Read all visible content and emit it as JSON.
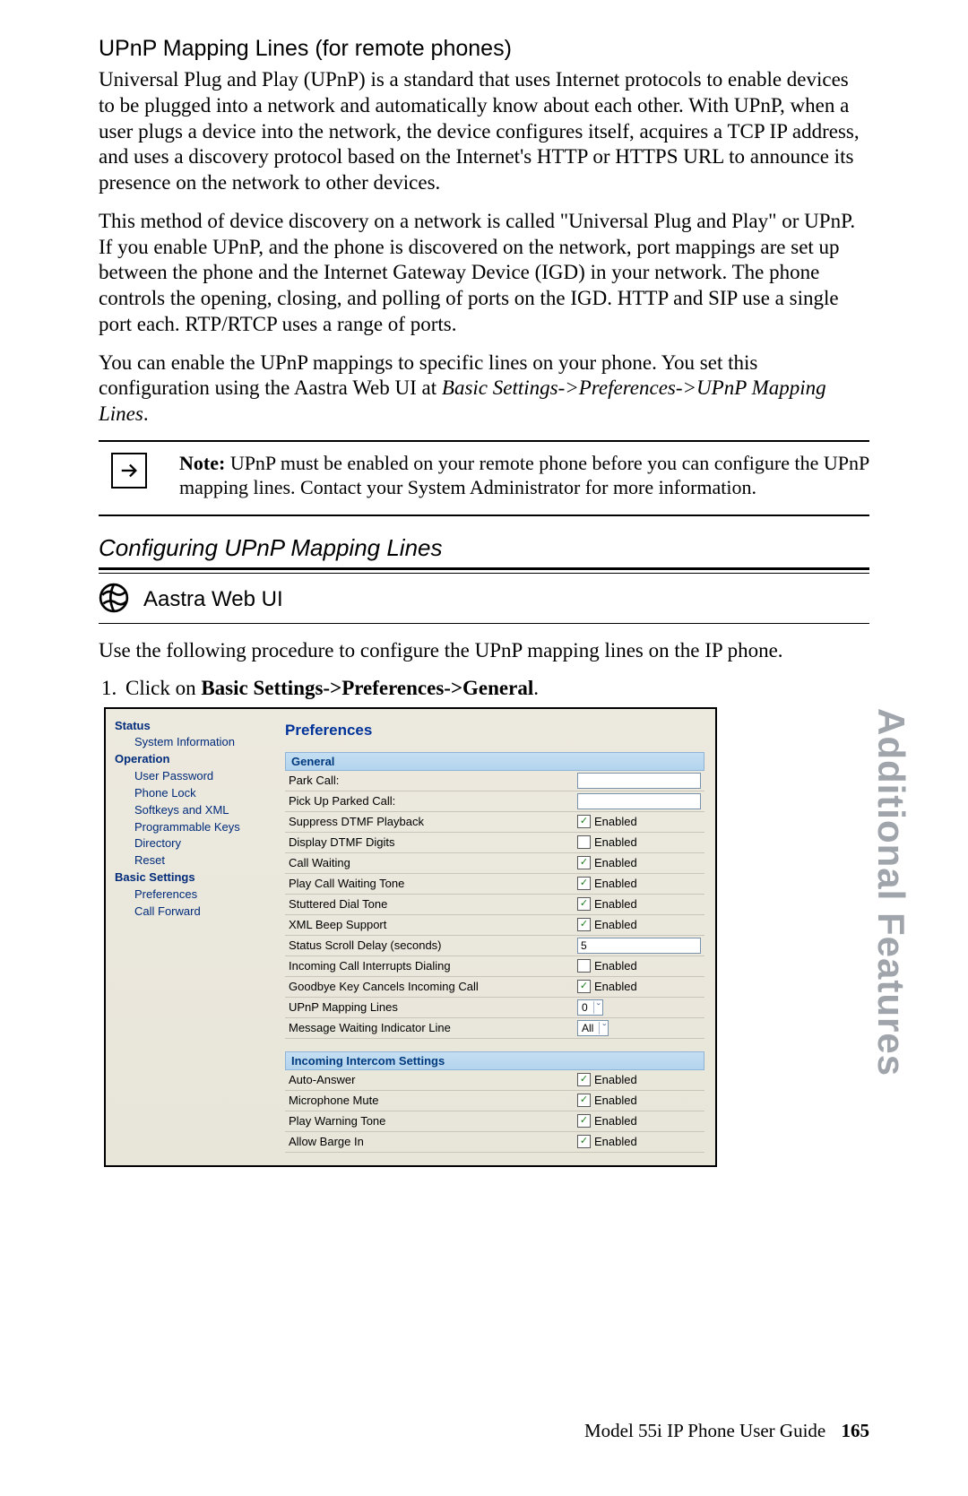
{
  "section": {
    "heading": "UPnP Mapping Lines (for remote phones)",
    "p1": "Universal Plug and Play (UPnP) is a standard that uses Internet protocols to enable devices to be plugged into a network and automatically know about each other. With UPnP, when a user plugs a device into the network, the device configures itself, acquires a TCP IP address, and uses a discovery protocol based on the Internet's HTTP or HTTPS URL to announce its presence on the network to other devices.",
    "p2": "This method of device discovery on a network is called \"Universal Plug and Play\" or UPnP. If you enable UPnP, and the phone is discovered on the network, port mappings are set up between the phone and the Internet Gateway Device (IGD) in your network. The phone controls the opening, closing, and polling of ports on the IGD. HTTP and SIP use a single port each. RTP/RTCP uses a range of ports.",
    "p3a": "You can enable the UPnP mappings to specific lines on your phone. You set this configuration using the Aastra Web UI at ",
    "p3b_italic": "Basic Settings->Preferences->UPnP Mapping Lines",
    "p3c": "."
  },
  "note": {
    "label": "Note:",
    "text": " UPnP must be enabled on your remote phone before you can configure the UPnP mapping lines. Contact your System Administrator for more information."
  },
  "subhead": "Configuring UPnP Mapping Lines",
  "webui_label": "Aastra Web UI",
  "procedure_intro": "Use the following procedure to configure the UPnP mapping lines on the IP phone.",
  "step1_pre": "Click on ",
  "step1_bold": "Basic Settings->Preferences->General",
  "step1_post": ".",
  "figure": {
    "nav": {
      "status": "Status",
      "status_items": [
        "System Information"
      ],
      "operation": "Operation",
      "operation_items": [
        "User Password",
        "Phone Lock",
        "Softkeys and XML",
        "Programmable Keys",
        "Directory",
        "Reset"
      ],
      "basic": "Basic Settings",
      "basic_items": [
        "Preferences",
        "Call Forward"
      ]
    },
    "title": "Preferences",
    "section_general": "General",
    "general_rows": [
      {
        "label": "Park Call:",
        "type": "text",
        "value": ""
      },
      {
        "label": "Pick Up Parked Call:",
        "type": "text",
        "value": ""
      },
      {
        "label": "Suppress DTMF Playback",
        "type": "check",
        "checked": true,
        "clabel": "Enabled"
      },
      {
        "label": "Display DTMF Digits",
        "type": "check",
        "checked": false,
        "clabel": "Enabled"
      },
      {
        "label": "Call Waiting",
        "type": "check",
        "checked": true,
        "clabel": "Enabled"
      },
      {
        "label": "Play Call Waiting Tone",
        "type": "check",
        "checked": true,
        "clabel": "Enabled"
      },
      {
        "label": "Stuttered Dial Tone",
        "type": "check",
        "checked": true,
        "clabel": "Enabled"
      },
      {
        "label": "XML Beep Support",
        "type": "check",
        "checked": true,
        "clabel": "Enabled"
      },
      {
        "label": "Status Scroll Delay (seconds)",
        "type": "text",
        "value": "5"
      },
      {
        "label": "Incoming Call Interrupts Dialing",
        "type": "check",
        "checked": false,
        "clabel": "Enabled"
      },
      {
        "label": "Goodbye Key Cancels Incoming Call",
        "type": "check",
        "checked": true,
        "clabel": "Enabled"
      },
      {
        "label": "UPnP Mapping Lines",
        "type": "select",
        "value": "0"
      },
      {
        "label": "Message Waiting Indicator Line",
        "type": "select",
        "value": "All"
      }
    ],
    "section_intercom": "Incoming Intercom Settings",
    "intercom_rows": [
      {
        "label": "Auto-Answer",
        "type": "check",
        "checked": true,
        "clabel": "Enabled"
      },
      {
        "label": "Microphone Mute",
        "type": "check",
        "checked": true,
        "clabel": "Enabled"
      },
      {
        "label": "Play Warning Tone",
        "type": "check",
        "checked": true,
        "clabel": "Enabled"
      },
      {
        "label": "Allow Barge In",
        "type": "check",
        "checked": true,
        "clabel": "Enabled"
      }
    ]
  },
  "sidetab": "Additional Features",
  "footer": {
    "book": "Model 55i IP Phone User Guide",
    "page": "165"
  }
}
